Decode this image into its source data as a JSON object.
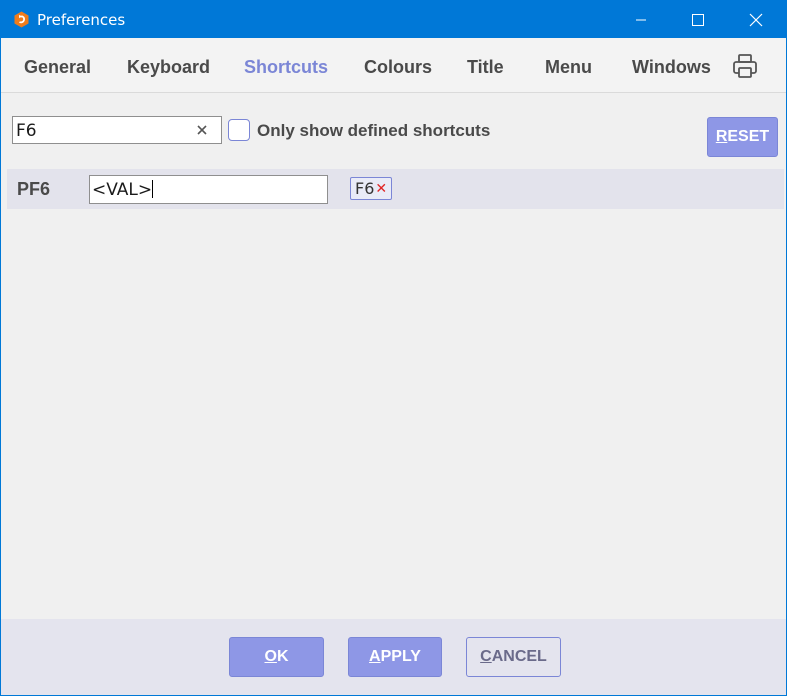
{
  "window": {
    "title": "Preferences"
  },
  "tabs": [
    {
      "label": "General",
      "active": false
    },
    {
      "label": "Keyboard",
      "active": false
    },
    {
      "label": "Shortcuts",
      "active": true
    },
    {
      "label": "Colours",
      "active": false
    },
    {
      "label": "Title",
      "active": false
    },
    {
      "label": "Menu",
      "active": false
    },
    {
      "label": "Windows",
      "active": false
    }
  ],
  "filter": {
    "search_value": "F6",
    "checkbox_label": "Only show defined shortcuts",
    "checkbox_checked": false,
    "reset_label": "RESET"
  },
  "shortcuts": [
    {
      "key": "PF6",
      "value": "<VAL>",
      "binding": "F6"
    }
  ],
  "footer": {
    "ok_label": "OK",
    "apply_label": "APPLY",
    "cancel_label": "CANCEL"
  },
  "colors": {
    "titlebar": "#0078d7",
    "accent": "#7b86d6",
    "button_fill": "#8e97e6",
    "remove_x": "#e02424"
  },
  "icons": {
    "app": "app-logo-icon",
    "minimize": "minimize-icon",
    "maximize": "maximize-icon",
    "close": "close-icon",
    "print": "printer-icon",
    "clear": "clear-icon",
    "remove_binding": "remove-x-icon"
  }
}
